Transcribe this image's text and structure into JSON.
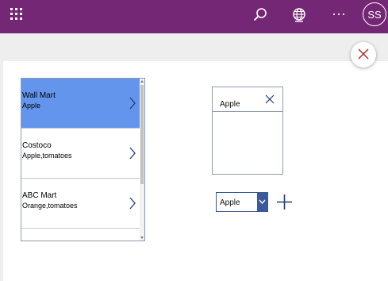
{
  "header": {
    "waffle_icon": "waffle-icon",
    "search_icon": "search-icon",
    "globe_icon": "globe-icon",
    "more_label": "···",
    "avatar_initials": "SS",
    "background": "#742774"
  },
  "close_icon": "close-icon",
  "gallery": {
    "items": [
      {
        "title": "Wall Mart",
        "subtitle": "Apple",
        "selected": true
      },
      {
        "title": "Costoco",
        "subtitle": "Apple,tomatoes",
        "selected": false
      },
      {
        "title": "ABC Mart",
        "subtitle": "Orange,tomatoes",
        "selected": false
      }
    ],
    "selected_color": "#6495ED"
  },
  "listbox": {
    "item": "Apple",
    "remove_icon": "close-icon"
  },
  "dropdown": {
    "value": "Apple",
    "accent": "#3B5A9A"
  },
  "add_icon": "plus-icon"
}
